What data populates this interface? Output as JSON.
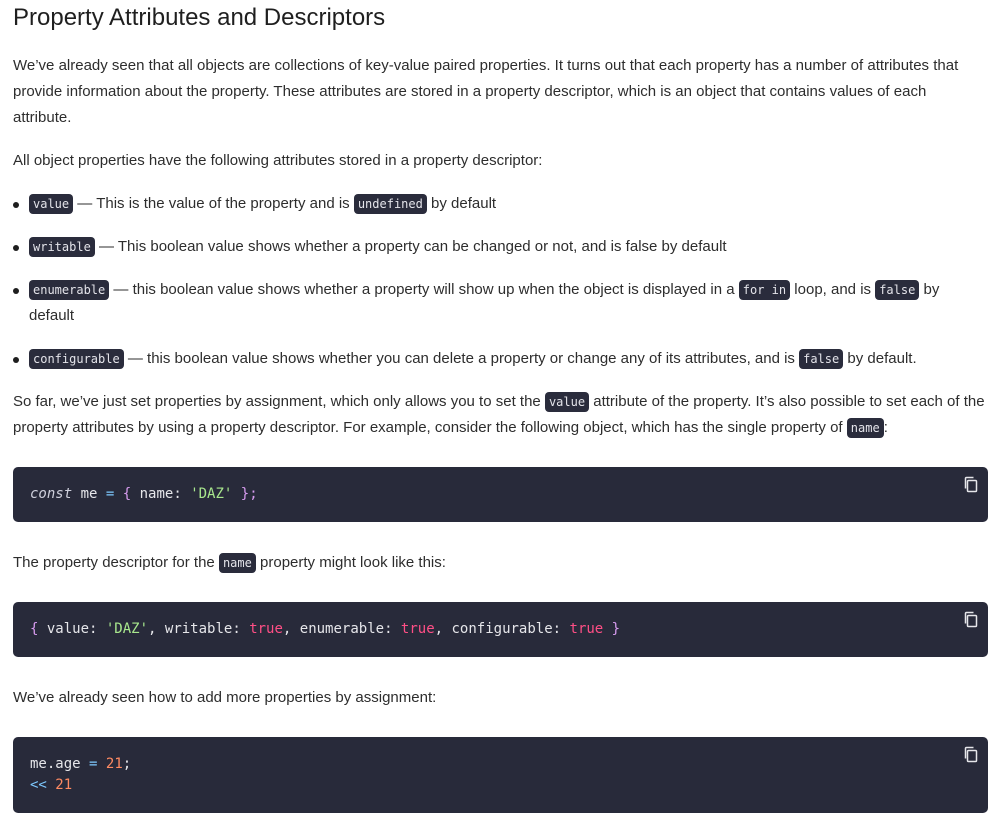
{
  "title": "Property Attributes and Descriptors",
  "intro": "We’ve already seen that all objects are collections of key-value paired properties. It turns out that each property has a number of attributes that provide information about the property. These attributes are stored in a property descriptor, which is an object that contains values of each attribute.",
  "attributes_intro": "All object properties have the following attributes stored in a property descriptor:",
  "bullets": [
    {
      "code": "value",
      "text_a": " — This is the value of the property and is ",
      "code2": "undefined",
      "text_b": " by default",
      "code3": "",
      "text_c": ""
    },
    {
      "code": "writable",
      "text_a": " — This boolean value shows whether a property can be changed or not, and is false by default",
      "code2": "",
      "text_b": "",
      "code3": "",
      "text_c": ""
    },
    {
      "code": "enumerable",
      "text_a": " — this boolean value shows whether a property will show up when the object is displayed in a ",
      "code2": "for in",
      "text_b": " loop, and is ",
      "code3": "false",
      "text_c": " by default"
    },
    {
      "code": "configurable",
      "text_a": " — this boolean value shows whether you can delete a property or change any of its attributes, and is ",
      "code2": "false",
      "text_b": " by default.",
      "code3": "",
      "text_c": ""
    }
  ],
  "para3": {
    "text_a": "So far, we’ve just set properties by assignment, which only allows you to set the ",
    "code_a": "value",
    "text_b": " attribute of the property. It’s also possible to set each of the property attributes by using a property descriptor. For example, consider the following object, which has the single property of ",
    "code_b": "name",
    "text_c": ":"
  },
  "code1": {
    "kw": "const",
    "ident": " me ",
    "op": "=",
    "open": " { ",
    "prop": "name",
    "colon": ": ",
    "str": "'DAZ'",
    "close": " };"
  },
  "para4": {
    "text_a": "The property descriptor for the ",
    "code": "name",
    "text_b": " property might look like this:"
  },
  "code2": {
    "open": "{ ",
    "k1": "value",
    "c1": ": ",
    "v1": "'DAZ'",
    "s1": ", ",
    "k2": "writable",
    "c2": ": ",
    "v2": "true",
    "s2": ", ",
    "k3": "enumerable",
    "c3": ": ",
    "v3": "true",
    "s3": ", ",
    "k4": "configurable",
    "c4": ": ",
    "v4": "true",
    "close": " }"
  },
  "para5": "We’ve already seen how to add more properties by assignment:",
  "code3": {
    "l1_obj": "me",
    "l1_dot": ".",
    "l1_prop": "age",
    "l1_op": " = ",
    "l1_num": "21",
    "l1_semi": ";",
    "l2_arrow": "<<",
    "l2_num": " 21"
  },
  "icons": {
    "copy": "copy-icon"
  },
  "colors": {
    "code_bg": "#282a3a",
    "inline_code_bg": "#2a2c3c",
    "string": "#a8e78d",
    "boolean": "#ff4f86",
    "number": "#ff8a62",
    "operator": "#7ec9ff",
    "brace": "#d89cf0"
  }
}
